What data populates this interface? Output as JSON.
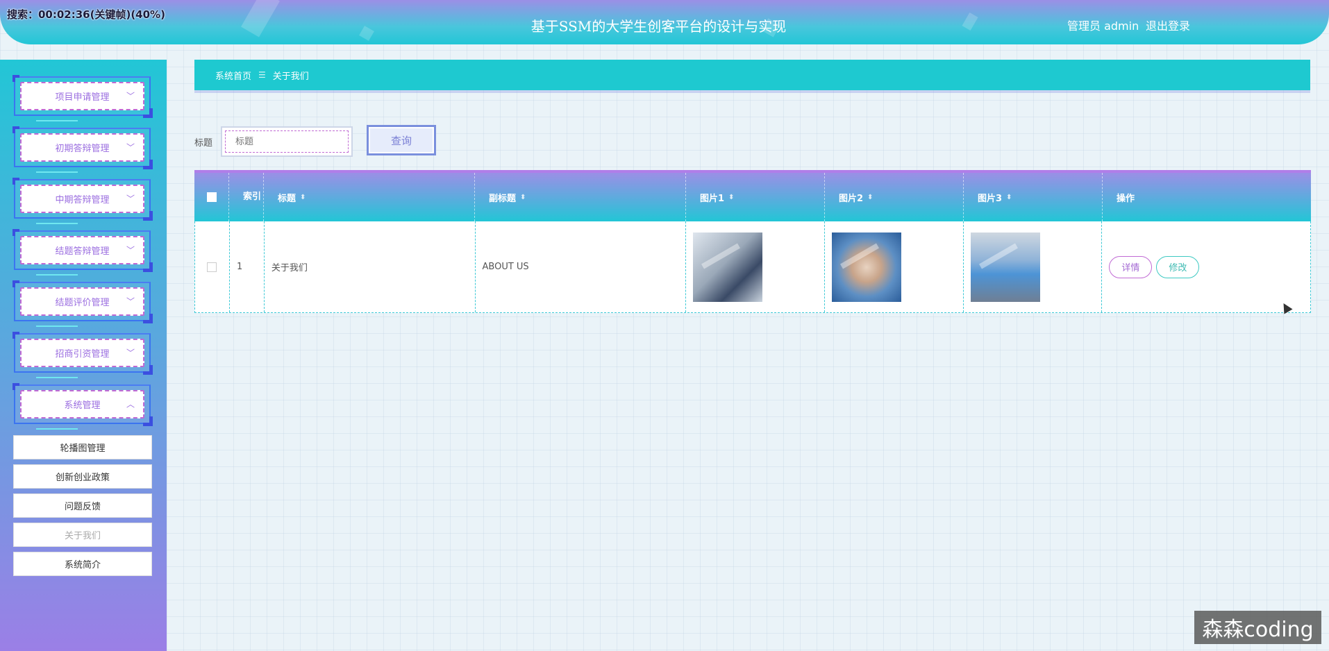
{
  "header": {
    "recording": "搜索：00:02:36(关键帧)(40%)",
    "title": "基于SSM的大学生创客平台的设计与实现",
    "user": "管理员 admin",
    "logout": "退出登录"
  },
  "sidebar": {
    "menus": [
      {
        "label": "项目申请管理",
        "chevron": "chevron-down"
      },
      {
        "label": "初期答辩管理",
        "chevron": "chevron-down"
      },
      {
        "label": "中期答辩管理",
        "chevron": "chevron-down"
      },
      {
        "label": "结题答辩管理",
        "chevron": "chevron-down"
      },
      {
        "label": "结题评价管理",
        "chevron": "chevron-down"
      },
      {
        "label": "招商引资管理",
        "chevron": "chevron-down"
      },
      {
        "label": "系统管理",
        "chevron": "chevron-up"
      }
    ],
    "sub_items": [
      "轮播图管理",
      "创新创业政策",
      "问题反馈",
      "关于我们",
      "系统简介"
    ],
    "active_sub": "关于我们"
  },
  "breadcrumb": {
    "home": "系统首页",
    "separator": "☰",
    "current": "关于我们"
  },
  "search": {
    "label": "标题",
    "placeholder": "标题",
    "button": "查询"
  },
  "table": {
    "headers": [
      "索引",
      "标题",
      "副标题",
      "图片1",
      "图片2",
      "图片3",
      "操作"
    ],
    "rows": [
      {
        "index": "1",
        "title": "关于我们",
        "subtitle": "ABOUT US",
        "images": [
          "image-laptop-hands",
          "image-teamwork-hands",
          "image-warehouse-map"
        ],
        "actions": [
          "详情",
          "修改"
        ]
      }
    ]
  },
  "watermark": "森森coding",
  "colors": {
    "accent_teal": "#1ec9d0",
    "accent_purple": "#9b8fe6",
    "menu_text": "#9b6ee0"
  }
}
